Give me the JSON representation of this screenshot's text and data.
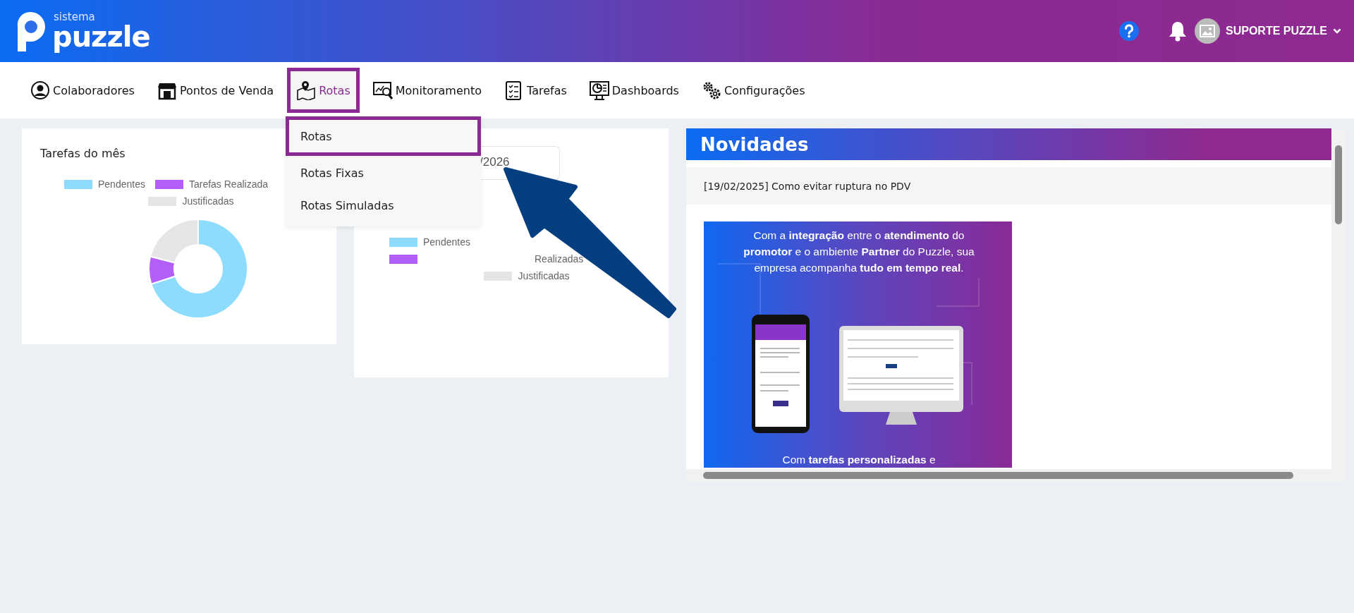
{
  "header": {
    "logo_small": "sistema",
    "logo": "puzzle",
    "user": "SUPORTE PUZZLE"
  },
  "nav": {
    "items": [
      {
        "label": "Colaboradores",
        "selected": false
      },
      {
        "label": "Pontos de Venda",
        "selected": false
      },
      {
        "label": "Rotas",
        "selected": true
      },
      {
        "label": "Monitoramento",
        "selected": false
      },
      {
        "label": "Tarefas",
        "selected": false
      },
      {
        "label": "Dashboards",
        "selected": false
      },
      {
        "label": "Configurações",
        "selected": false
      }
    ]
  },
  "dropdown": {
    "items": [
      {
        "label": "Rotas",
        "selected": true
      },
      {
        "label": "Rotas Fixas",
        "selected": false
      },
      {
        "label": "Rotas Simuladas",
        "selected": false
      }
    ]
  },
  "tasks_card": {
    "title": "Tarefas do mês",
    "legend": [
      {
        "label": "Pendentes",
        "color": "#8ddcfe"
      },
      {
        "label": "Tarefas Realizada",
        "color": "#b25ff8"
      },
      {
        "label": "Justificadas",
        "color": "#e5e5e5"
      }
    ]
  },
  "second_card": {
    "date_field": {
      "value": "/2026"
    },
    "legend": [
      {
        "label": "Pendentes",
        "color": "#8ddcfe"
      },
      {
        "label": "Realizadas",
        "color": "#b25ff8"
      },
      {
        "label": "Justificadas",
        "color": "#e5e5e5"
      }
    ]
  },
  "news": {
    "title": "Novidades",
    "item_title": "[19/02/2025] Como evitar ruptura no PDV",
    "banner": {
      "kind": "picture",
      "text": "Com a **integração** entre o **atendimento** do **promotor** e o ambiente **Partner** do Puzzle, sua empresa acompanha **tudo em tempo real**.",
      "footer": "Com **tarefas personalizadas** e"
    }
  }
}
